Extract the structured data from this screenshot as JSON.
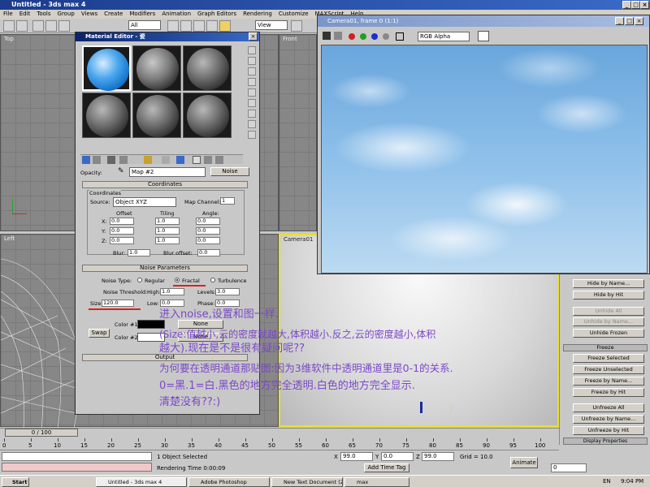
{
  "app": {
    "title": "Untitled - 3ds max 4"
  },
  "menu": [
    "File",
    "Edit",
    "Tools",
    "Group",
    "Views",
    "Create",
    "Modifiers",
    "Animation",
    "Graph Editors",
    "Rendering",
    "Customize",
    "MAXScript",
    "Help"
  ],
  "toolbar": {
    "selection_filter": "All",
    "ref_coord": "View"
  },
  "viewports": {
    "top": "Top",
    "front": "Front",
    "left": "Left",
    "camera": "Camera01"
  },
  "material_editor": {
    "title": "Material Editor - 瓷",
    "opacity_label": "Opacity:",
    "map_name": "Map #2",
    "map_type": "Noise",
    "coordinates": {
      "header": "Coordinates",
      "group": "Coordinates",
      "source_label": "Source:",
      "source_value": "Object XYZ",
      "map_channel_label": "Map Channel:",
      "map_channel_value": "1",
      "offset_label": "Offset",
      "tiling_label": "Tiling",
      "angle_label": "Angle:",
      "rows": [
        {
          "axis": "X:",
          "offset": "0.0",
          "tiling": "1.0",
          "angle": "0.0"
        },
        {
          "axis": "Y:",
          "offset": "0.0",
          "tiling": "1.0",
          "angle": "0.0"
        },
        {
          "axis": "Z:",
          "offset": "0.0",
          "tiling": "1.0",
          "angle": "0.0"
        }
      ],
      "blur_label": "Blur:",
      "blur_value": "1.0",
      "blur_offset_label": "Blur offset:",
      "blur_offset_value": "0.0"
    },
    "noise": {
      "header": "Noise Parameters",
      "type_label": "Noise Type:",
      "types": [
        "Regular",
        "Fractal",
        "Turbulence"
      ],
      "selected_type": "Fractal",
      "threshold_label": "Noise Threshold:",
      "high_label": "High:",
      "high_value": "1.0",
      "levels_label": "Levels:",
      "levels_value": "3.0",
      "size_label": "Size:",
      "size_value": "120.0",
      "low_label": "Low:",
      "low_value": "0.0",
      "phase_label": "Phase:",
      "phase_value": "0.0",
      "swap_label": "Swap",
      "color1_label": "Color #1",
      "color2_label": "Color #2",
      "color1": "#000000",
      "color2": "#ffffff",
      "map1": "None",
      "map2": "None"
    },
    "output_header": "Output"
  },
  "camera_window": {
    "title": "Camera01, frame 0 (1:1)",
    "channel": "RGB Alpha"
  },
  "command_panel": {
    "buttons": [
      "Hide by Name...",
      "Hide by Hit",
      "Unhide All",
      "Unhide by Name...",
      "Unhide Frozen"
    ],
    "freeze_header": "Freeze",
    "freeze_buttons": [
      "Freeze Selected",
      "Freeze Unselected",
      "Freeze by Name...",
      "Freeze by Hit",
      "Unfreeze All",
      "Unfreeze by Name...",
      "Unfreeze by Hit"
    ],
    "display_header": "Display Properties"
  },
  "timeline": {
    "slider_text": "0 / 100",
    "ticks": [
      "0",
      "5",
      "10",
      "15",
      "20",
      "25",
      "30",
      "35",
      "40",
      "45",
      "50",
      "55",
      "60",
      "65",
      "70",
      "75",
      "80",
      "85",
      "90",
      "95",
      "100"
    ]
  },
  "status": {
    "selection": "1 Object Selected",
    "render_time": "Rendering Time  0:00:09",
    "x_value": "99.0",
    "y_value": "0.0",
    "z_value": "99.0",
    "grid": "Grid = 10.0",
    "add_time_tag": "Add Time Tag",
    "animate": "Animate",
    "frame": "0"
  },
  "taskbar": {
    "start": "Start",
    "tasks": [
      "Untitled - 3ds max 4",
      "Adobe Photoshop",
      "New Text Document (2).t...",
      "max"
    ],
    "clock": "9:04 PM",
    "lang": "EN"
  },
  "annotation": {
    "line1": "进入noise,设置和图一样.",
    "line2": "(Size:值越小,云的密度就越大,体积越小.反之,云的密度越小,体积",
    "line3": "越大).现在是不是很有疑问呢??",
    "line4": "为何要在透明通道那贴图:因为3维软件中透明通道里是0-1的关系.",
    "line5": "0=黑.1=白.黑色的地方完全透明.白色的地方完全显示.",
    "line6": "清楚没有??:)"
  }
}
